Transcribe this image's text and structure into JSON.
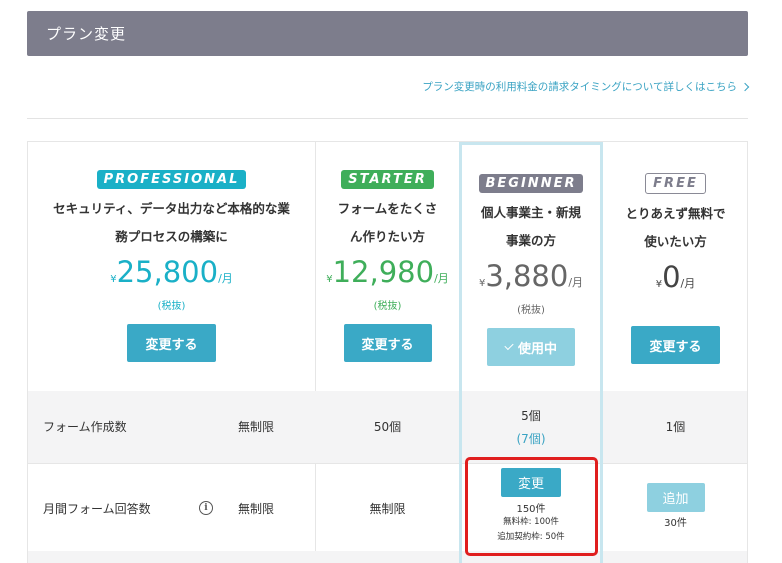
{
  "header": {
    "title": "プラン変更"
  },
  "billing_link": "プラン変更時の利用料金の請求タイミングについて詳しくはこちら",
  "plans": [
    {
      "badge": "PROFESSIONAL",
      "desc_line1": "セキュリティ、データ出力など本格的な業",
      "desc_line2": "務プロセスの構築に",
      "yen": "¥",
      "amount": "25,800",
      "unit": "/月",
      "tax": "(税抜)",
      "button": "変更する",
      "color": "#1ab0c7"
    },
    {
      "badge": "STARTER",
      "desc_line1": "フォームをたくさ",
      "desc_line2": "ん作りたい方",
      "yen": "¥",
      "amount": "12,980",
      "unit": "/月",
      "tax": "(税抜)",
      "button": "変更する",
      "color": "#3fae5a"
    },
    {
      "badge": "BEGINNER",
      "desc_line1": "個人事業主・新規",
      "desc_line2": "事業の方",
      "yen": "¥",
      "amount": "3,880",
      "unit": "/月",
      "tax": "(税抜)",
      "button": "使用中",
      "color": "#7d7d8c"
    },
    {
      "badge": "FREE",
      "desc_line1": "とりあえず無料で",
      "desc_line2": "使いたい方",
      "yen": "¥",
      "amount": "0",
      "unit": "/月",
      "tax": "",
      "button": "変更する",
      "color": "#7d7d8c"
    }
  ],
  "rows": [
    {
      "label": "フォーム作成数",
      "professional": "無制限",
      "starter": "50個",
      "beginner": "5個",
      "beginner_extra": "(7個)",
      "free": "1個"
    },
    {
      "label": "月間フォーム回答数",
      "info_icon": "i",
      "professional": "無制限",
      "starter": "無制限",
      "beginner_button": "変更",
      "beginner": "150件",
      "beginner_note1": "無料枠: 100件",
      "beginner_note2": "追加契約枠: 50件",
      "free_button": "追加",
      "free": "30件"
    }
  ]
}
